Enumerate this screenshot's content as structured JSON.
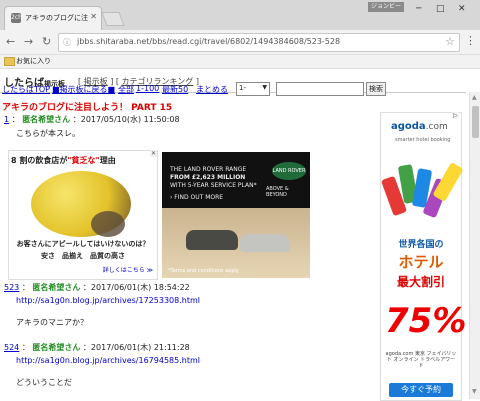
{
  "browser": {
    "tab_title": "アキラのブログに注目しよう！",
    "tab_favicon": "2ch",
    "window_badge": "ジョンビー",
    "url": "jbbs.shitaraba.net/bbs/read.cgi/travel/6802/1494384608/523-528",
    "bookmarks": {
      "folder": "お気に入り"
    }
  },
  "site": {
    "logo": "したらば",
    "logo_sub": "掲示板",
    "nav": [
      "掲示板",
      "カテゴリランキング"
    ],
    "links": {
      "top": "したらばTOP",
      "back": "■掲示板に戻る■",
      "all": "全部",
      "range": "1-100",
      "latest": "最新50",
      "summary": "まとめる"
    },
    "select_value": "1-",
    "search_button": "検索"
  },
  "thread": {
    "title": "アキラのブログに注目しよう！ PART 15"
  },
  "posts": [
    {
      "num": "1",
      "name": "匿名希望さん",
      "date": "：2017/05/10(水) 11:50:08",
      "body": [
        "こちらが本スレ。"
      ],
      "link": ""
    },
    {
      "num": "523",
      "name": "匿名希望さん",
      "date": "：2017/06/01(木) 18:54:22",
      "link": "http://sa1g0n.blog.jp/archives/17253308.html",
      "body": [
        "アキラのマニアか？"
      ]
    },
    {
      "num": "524",
      "name": "匿名希望さん",
      "date": "：2017/06/01(木) 21:11:28",
      "link": "http://sa1g0n.blog.jp/archives/16794585.html",
      "body": [
        "どういうことだ"
      ]
    }
  ],
  "ads": {
    "left": {
      "headline_a": "8 割の飲食店が",
      "headline_b": "\"貧乏な\"",
      "headline_c": "理由",
      "question": "お客さんにアピールしてはいけないのは？",
      "keywords": "安さ　品揃え　品質の高さ",
      "more": "詳しくはこちら ≫"
    },
    "mid": {
      "brand": "LAND ROVER",
      "tagline": "ABOVE & BEYOND",
      "line1": "THE LAND ROVER RANGE",
      "line2": "FROM £2,623 MILLION",
      "line3": "WITH 5-YEAR SERVICE PLAN*",
      "cta": "› FIND OUT MORE",
      "terms": "*Terms and conditions apply"
    },
    "right": {
      "brand": "agoda",
      "brand_suffix": ".com",
      "tag": "smarter hotel booking",
      "hl1": "世界各国の",
      "hl2": "ホテル",
      "hl3": "最大割引",
      "big": "75%",
      "small": "agoda.com 東京\nフェイバリット オンライン\nトラベルアワード",
      "cta": "今すぐ予約"
    }
  }
}
